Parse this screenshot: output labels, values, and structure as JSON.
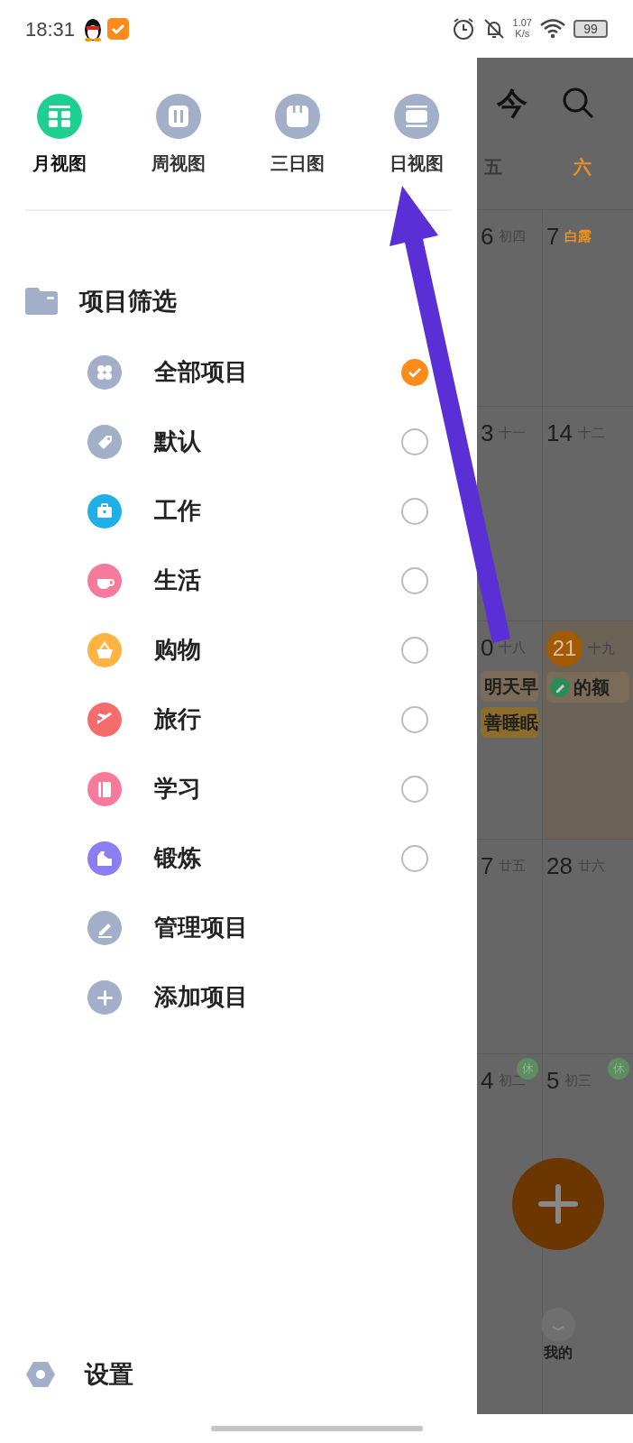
{
  "status_bar": {
    "time": "18:31",
    "net_speed": "1.07",
    "net_unit": "K/s",
    "battery": "99"
  },
  "view_modes": [
    {
      "label": "月视图",
      "kind": "month",
      "selected": true
    },
    {
      "label": "周视图",
      "kind": "week",
      "selected": false
    },
    {
      "label": "三日图",
      "kind": "three",
      "selected": false
    },
    {
      "label": "日视图",
      "kind": "day",
      "selected": false
    }
  ],
  "filter": {
    "title": "项目筛选"
  },
  "projects": [
    {
      "label": "全部项目",
      "kind": "all",
      "color": "#a3aec8",
      "checked": true
    },
    {
      "label": "默认",
      "kind": "tag",
      "color": "#a3aec8",
      "checked": false
    },
    {
      "label": "工作",
      "kind": "work",
      "color": "#1fb0e6",
      "checked": false
    },
    {
      "label": "生活",
      "kind": "cup",
      "color": "#f77a9d",
      "checked": false
    },
    {
      "label": "购物",
      "kind": "basket",
      "color": "#ffb340",
      "checked": false
    },
    {
      "label": "旅行",
      "kind": "plane",
      "color": "#f56c6c",
      "checked": false
    },
    {
      "label": "学习",
      "kind": "book",
      "color": "#f77a9d",
      "checked": false
    },
    {
      "label": "锻炼",
      "kind": "arm",
      "color": "#8a7ef0",
      "checked": false
    }
  ],
  "actions": [
    {
      "label": "管理项目",
      "kind": "manage"
    },
    {
      "label": "添加项目",
      "kind": "add"
    }
  ],
  "settings": {
    "label": "设置"
  },
  "calendar": {
    "today_button": "今",
    "weekdays": [
      {
        "label": "五",
        "weekend": false
      },
      {
        "label": "六",
        "weekend": true
      }
    ],
    "rows": [
      [
        {
          "day": "6",
          "lunar": "初四",
          "solar_term": false
        },
        {
          "day": "7",
          "lunar": "白露",
          "solar_term": true
        }
      ],
      [
        {
          "day": "3",
          "lunar": "十一",
          "solar_term": false
        },
        {
          "day": "14",
          "lunar": "十二",
          "solar_term": false
        }
      ],
      [
        {
          "day": "0",
          "lunar": "十八",
          "solar_term": false,
          "events": [
            {
              "label": "明天早",
              "color": "#7a6c58"
            },
            {
              "label": "善睡眠",
              "color": "#8c6d2c"
            }
          ]
        },
        {
          "day": "21",
          "lunar": "十九",
          "solar_term": false,
          "today": true,
          "events": [
            {
              "label": "的额",
              "color": "#7a6c58",
              "done": true
            }
          ]
        }
      ],
      [
        {
          "day": "7",
          "lunar": "廿五",
          "solar_term": false
        },
        {
          "day": "28",
          "lunar": "廿六",
          "solar_term": false
        }
      ],
      [
        {
          "day": "4",
          "lunar": "初二",
          "solar_term": false,
          "badge": "休"
        },
        {
          "day": "5",
          "lunar": "初三",
          "solar_term": false,
          "badge": "休"
        }
      ]
    ],
    "tab_label": "我的"
  }
}
